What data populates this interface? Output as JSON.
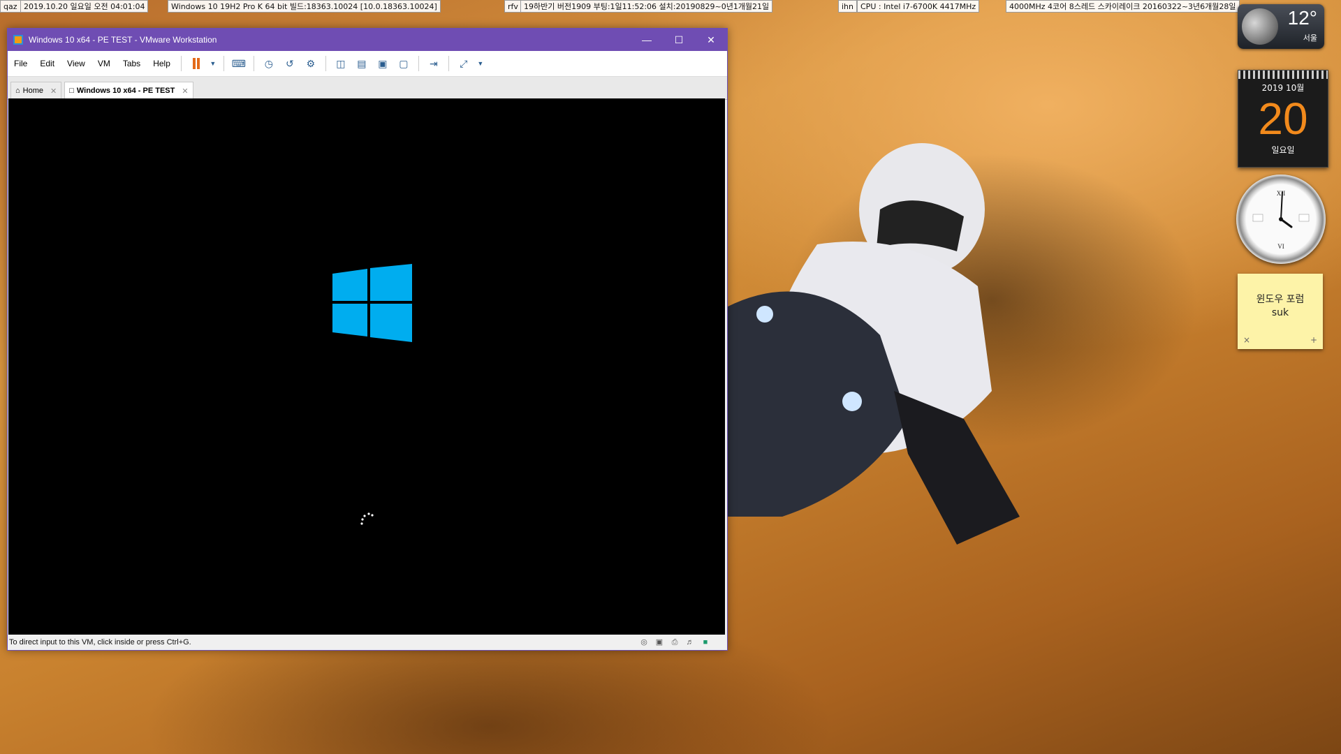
{
  "desktop": {
    "info_strips": [
      {
        "text": "qaz"
      },
      {
        "text": "2019.10.20 일요일 오전 04:01:04"
      },
      {
        "text": "Windows 10 19H2 Pro K 64 bit 빌드:18363.10024 [10.0.18363.10024]"
      },
      {
        "text": "rfv"
      },
      {
        "text": "19하반기 버전1909 부팅:1일11:52:06 설치:20190829~0년1개월21일"
      },
      {
        "text": "ihn"
      },
      {
        "text": "CPU : Intel i7-6700K 4417MHz"
      },
      {
        "text": "4000MHz 4코어 8스레드 스카이레이크 20160322~3년6개월28일"
      }
    ]
  },
  "vmware": {
    "title": "Windows 10 x64 - PE TEST - VMware Workstation",
    "menus": [
      "File",
      "Edit",
      "View",
      "VM",
      "Tabs",
      "Help"
    ],
    "tabs": [
      {
        "label": "Home"
      },
      {
        "label": "Windows 10 x64 - PE TEST"
      }
    ],
    "status_message": "To direct input to this VM, click inside or press Ctrl+G.",
    "logo_color": "#00adef"
  },
  "gadgets": {
    "weather": {
      "temp": "12°",
      "city": "서울"
    },
    "calendar": {
      "month": "2019 10월",
      "day": "20",
      "weekday": "일요일"
    },
    "clock": {
      "time": "04:01"
    },
    "note": {
      "line1": "윈도우 포럼",
      "line2": "suk",
      "close": "×",
      "add": "+"
    }
  }
}
